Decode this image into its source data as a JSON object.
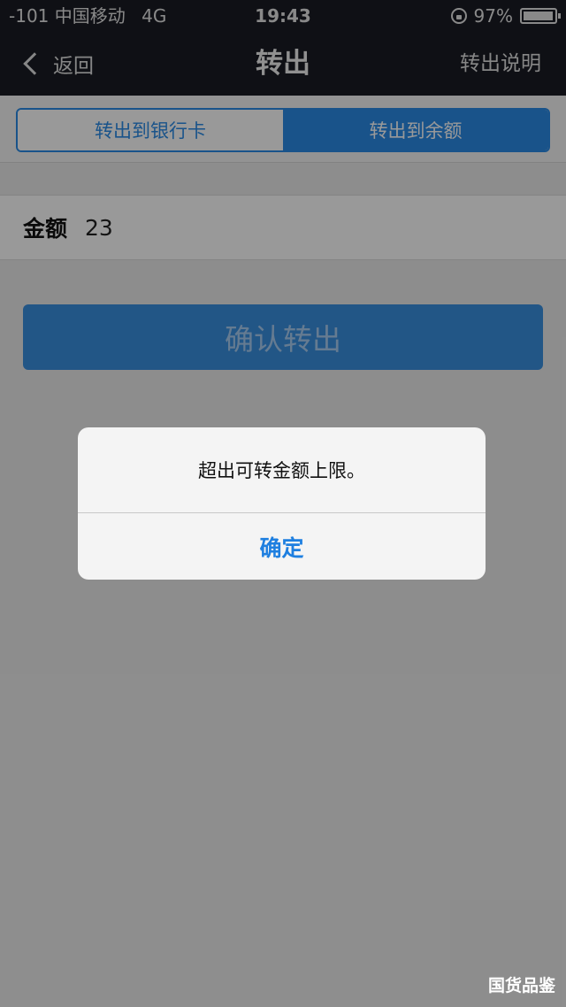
{
  "status_bar": {
    "carrier": "-101 中国移动",
    "network": "4G",
    "time": "19:43",
    "battery": "97%"
  },
  "nav": {
    "back_label": "返回",
    "title": "转出",
    "right_label": "转出说明"
  },
  "tabs": [
    {
      "label": "转出到银行卡",
      "selected": false
    },
    {
      "label": "转出到余额",
      "selected": true
    }
  ],
  "amount": {
    "label": "金额",
    "value": "23"
  },
  "confirm_button": {
    "label": "确认转出"
  },
  "alert": {
    "message": "超出可转金额上限。",
    "ok_label": "确定"
  },
  "watermark": "国货品鉴",
  "colors": {
    "accent": "#2b8be6",
    "navbar": "#191c24"
  }
}
